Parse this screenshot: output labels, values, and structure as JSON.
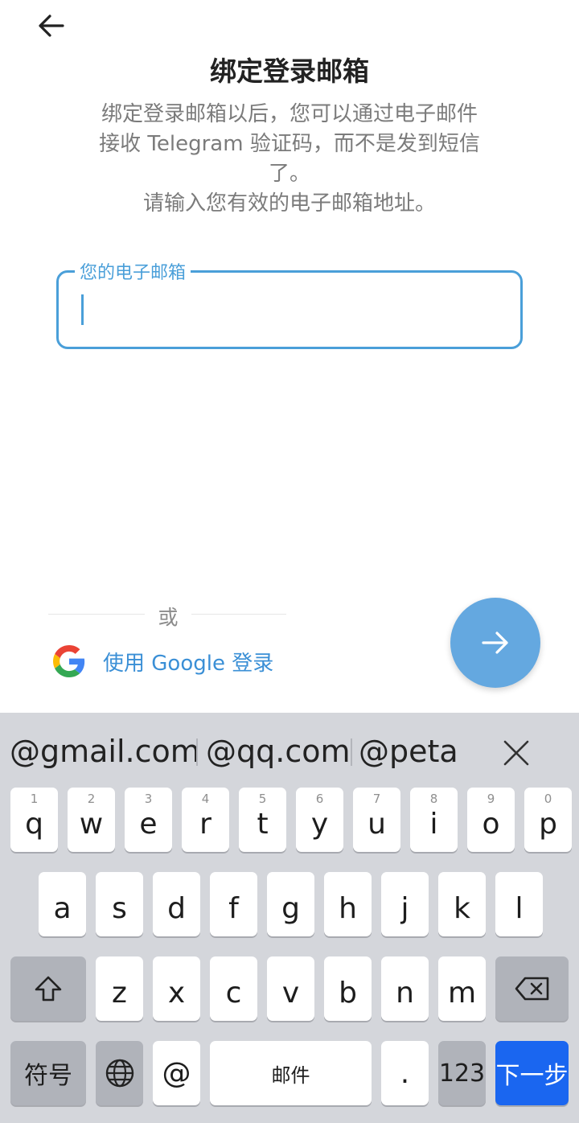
{
  "header": {
    "back_icon": "arrow-left-icon",
    "title": "绑定登录邮箱",
    "description_lines": [
      "绑定登录邮箱以后，您可以通过电子邮件",
      "接收 Telegram 验证码，而不是发到短信",
      "了。",
      "请输入您有效的电子邮箱地址。"
    ]
  },
  "email_field": {
    "label": "您的电子邮箱",
    "value": "",
    "accent_color": "#4a9fd9"
  },
  "alternative": {
    "or_label": "或",
    "google_button_label": "使用 Google 登录",
    "google_icon": "google-logo-icon"
  },
  "next_button": {
    "icon": "arrow-right-icon",
    "color": "#64a8e0"
  },
  "keyboard": {
    "suggestions": [
      "@gmail.com",
      "@qq.com",
      "@peta"
    ],
    "close_icon": "close-icon",
    "row1": [
      {
        "char": "q",
        "num": "1"
      },
      {
        "char": "w",
        "num": "2"
      },
      {
        "char": "e",
        "num": "3"
      },
      {
        "char": "r",
        "num": "4"
      },
      {
        "char": "t",
        "num": "5"
      },
      {
        "char": "y",
        "num": "6"
      },
      {
        "char": "u",
        "num": "7"
      },
      {
        "char": "i",
        "num": "8"
      },
      {
        "char": "o",
        "num": "9"
      },
      {
        "char": "p",
        "num": "0"
      }
    ],
    "row2": [
      "a",
      "s",
      "d",
      "f",
      "g",
      "h",
      "j",
      "k",
      "l"
    ],
    "row3": [
      "z",
      "x",
      "c",
      "v",
      "b",
      "n",
      "m"
    ],
    "shift_icon": "shift-icon",
    "backspace_icon": "backspace-icon",
    "bottom": {
      "symbols_label": "符号",
      "globe_icon": "globe-icon",
      "at_label": "@",
      "space_label": "邮件",
      "dot_label": ".",
      "numbers_label": "123",
      "next_label": "下一步",
      "next_color": "#1a66f0"
    }
  }
}
